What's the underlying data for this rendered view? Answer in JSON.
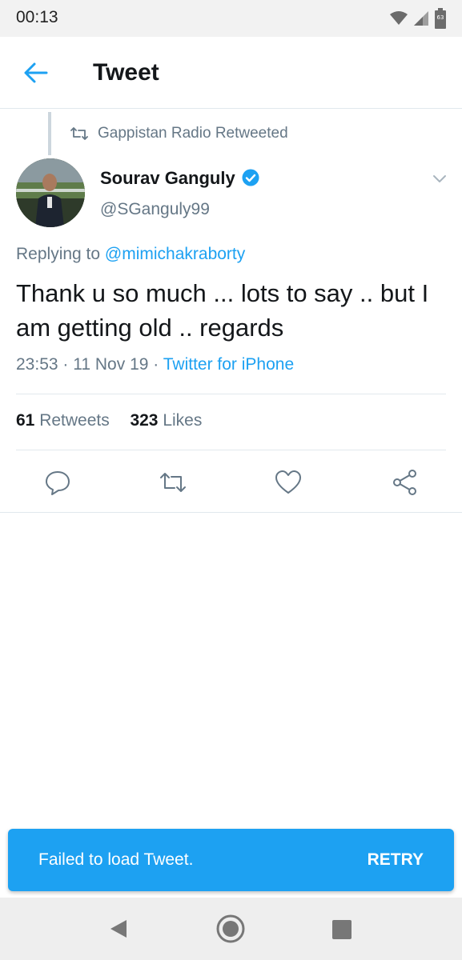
{
  "status_bar": {
    "time": "00:13",
    "battery_level": "63",
    "icons": [
      "wifi-icon",
      "signal-icon",
      "battery-icon"
    ]
  },
  "header": {
    "title": "Tweet",
    "back_icon": "back-arrow-icon"
  },
  "retweet_context": {
    "icon": "retweet-icon",
    "text": "Gappistan Radio Retweeted"
  },
  "tweet": {
    "author_name": "Sourav Ganguly",
    "verified": true,
    "handle": "@SGanguly99",
    "replying_prefix": "Replying to",
    "replying_to": "@mimichakraborty",
    "text": "Thank u so much ... lots to say .. but I am getting old .. regards",
    "time": "23:53",
    "date": "11 Nov 19",
    "source": "Twitter for iPhone",
    "retweet_count": "61",
    "retweet_label": "Retweets",
    "like_count": "323",
    "like_label": "Likes"
  },
  "actions": [
    "reply-icon",
    "retweet-icon",
    "like-icon",
    "share-icon"
  ],
  "snackbar": {
    "message": "Failed to load Tweet.",
    "action_label": "RETRY"
  },
  "nav_bar": [
    "back-triangle-icon",
    "home-circle-icon",
    "recents-square-icon"
  ],
  "colors": {
    "accent": "#1da1f2",
    "muted": "#657786",
    "text": "#14171a",
    "divider": "#e1e8ed"
  }
}
